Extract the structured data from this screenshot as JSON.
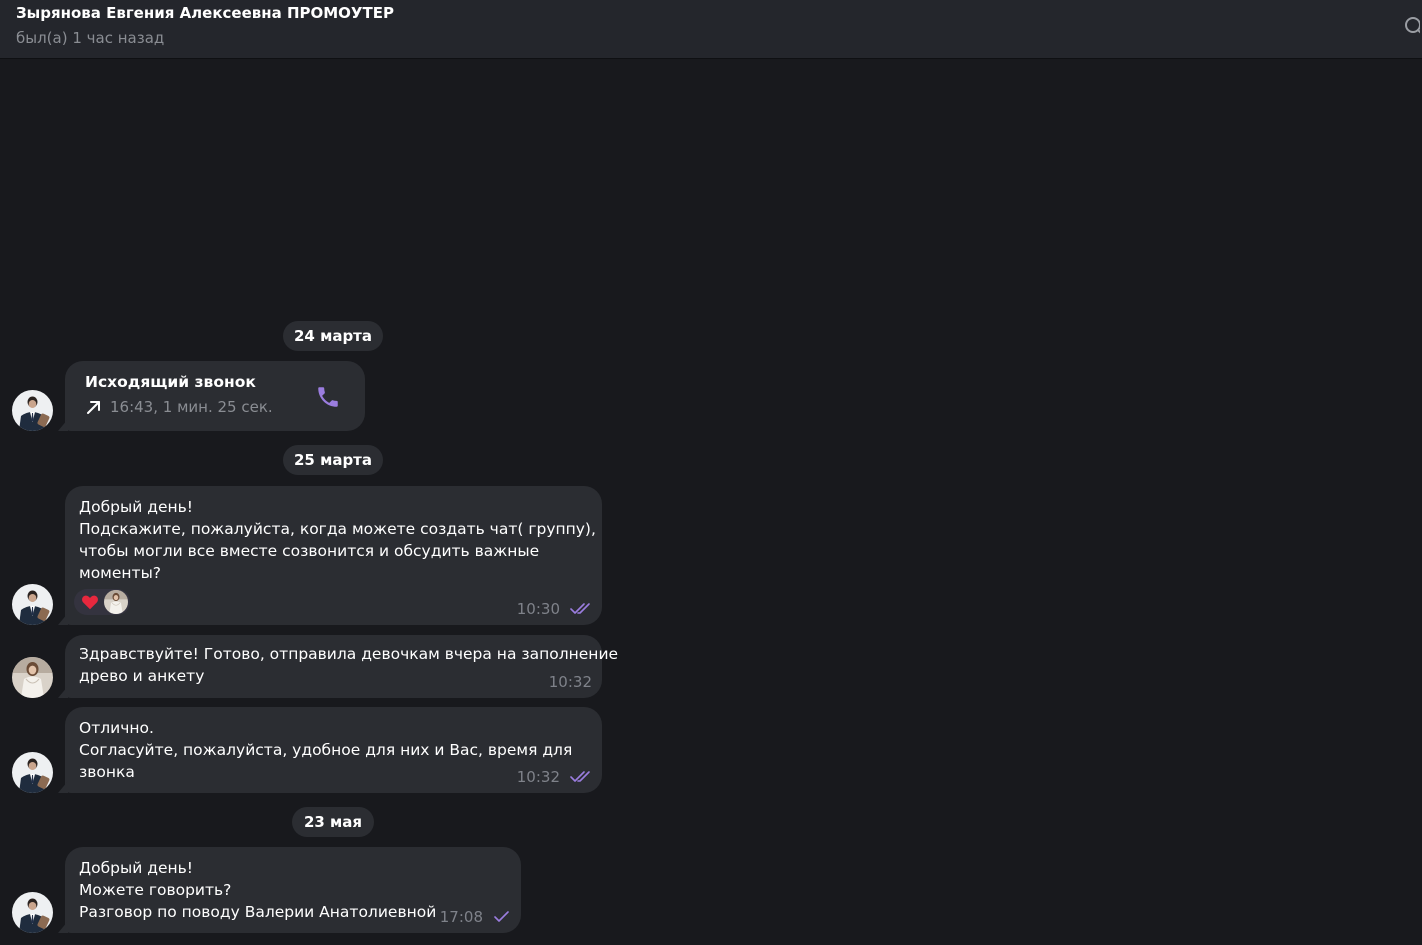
{
  "header": {
    "title": "Зырянова Евгения Алексеевна ПРОМОУТЕР",
    "status": "был(а) 1 час назад"
  },
  "colors": {
    "background": "#18191d",
    "header_bg": "#24262c",
    "bubble_bg": "#2b2d32",
    "accent_purple": "#9b7ddf",
    "secondary_text": "#8a8d93",
    "heart": "#e8283e"
  },
  "dates": {
    "d1": "24 марта",
    "d2": "25 марта",
    "d3": "23 мая"
  },
  "call": {
    "title": "Исходящий звонок",
    "detail": "16:43, 1 мин. 25 сек.",
    "icon": "phone-icon",
    "direction_icon": "outgoing-arrow-icon"
  },
  "messages": {
    "m1": {
      "text": "Добрый день!\nПодскажите, пожалуйста, когда можете создать чат( группу),\nчтобы могли все вместе созвонится и обсудить важные\nмоменты?",
      "time": "10:30",
      "status_icon": "double-check-icon",
      "reaction": "heart-icon"
    },
    "m2": {
      "text": "Здравствуйте! Готово, отправила девочкам вчера на заполнение\nдрево и анкету",
      "time": "10:32"
    },
    "m3": {
      "text": "Отлично.\nСогласуйте, пожалуйста, удобное для них и Вас, время для\nзвонка",
      "time": "10:32",
      "status_icon": "double-check-icon"
    },
    "m4": {
      "text": "Добрый день!\nМожете говорить?\nРазговор по поводу Валерии Анатолиевной",
      "time": "17:08",
      "status_icon": "single-check-icon"
    }
  }
}
